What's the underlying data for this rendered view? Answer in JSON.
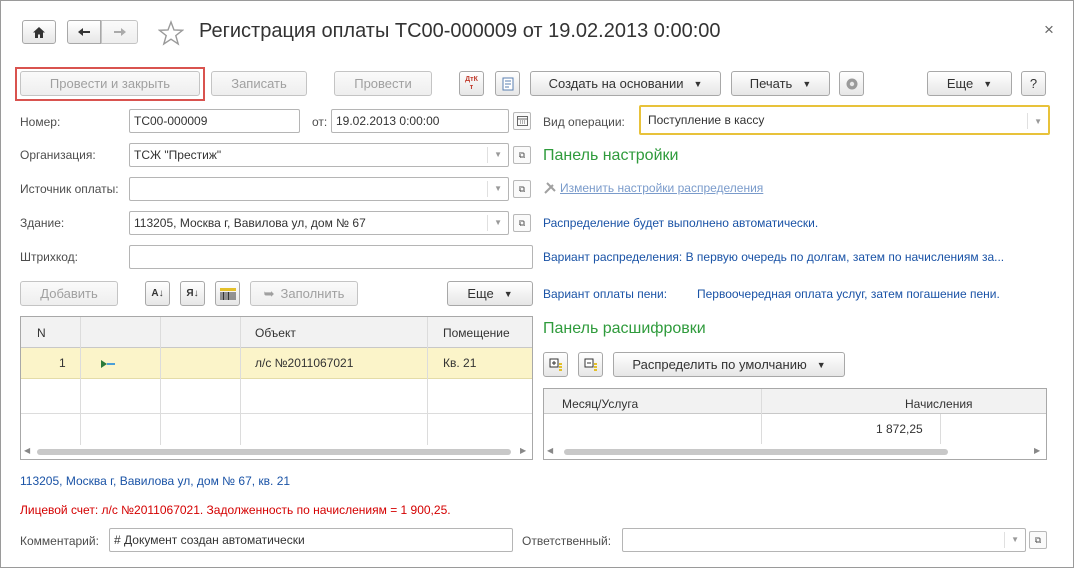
{
  "window": {
    "title": "Регистрация оплаты ТС00-000009 от 19.02.2013 0:00:00",
    "home_icon": "home-icon",
    "back_icon": "arrow-left-icon",
    "forward_icon": "arrow-right-icon",
    "favorite_icon": "star-icon",
    "close_icon": "close-icon",
    "close_glyph": "×"
  },
  "toolbar": {
    "post_close": "Провести и закрыть",
    "save": "Записать",
    "post": "Провести",
    "dtkt": "ДтКт",
    "create_based_on": "Создать на основании",
    "print": "Печать",
    "more": "Еще",
    "help": "?"
  },
  "form": {
    "number_label": "Номер:",
    "number_value": "ТС00-000009",
    "from_label": "от:",
    "date_value": "19.02.2013  0:00:00",
    "org_label": "Организация:",
    "org_value": "ТСЖ \"Престиж\"",
    "source_label": "Источник оплаты:",
    "source_value": "",
    "building_label": "Здание:",
    "building_value": "113205, Москва г, Вавилова ул, дом № 67",
    "barcode_label": "Штрихкод:",
    "barcode_value": "",
    "operation_label": "Вид операции:",
    "operation_value": "Поступление в кассу"
  },
  "table_toolbar": {
    "add": "Добавить",
    "fill": "Заполнить",
    "more": "Еще"
  },
  "table": {
    "columns": [
      "N",
      "",
      "",
      "Объект",
      "Помещение"
    ],
    "rows": [
      {
        "n": "1",
        "object": "л/с №2011067021",
        "room": "Кв. 21"
      }
    ]
  },
  "settings_panel": {
    "title": "Панель настройки",
    "change_link": "Изменить настройки распределения",
    "auto_text": "Распределение будет выполнено автоматически.",
    "variant_text": "Вариант распределения: В первую очередь по долгам, затем по начислениям за...",
    "penalty_label": "Вариант оплаты пени:",
    "penalty_value": "Первоочередная оплата услуг, затем погашение пени."
  },
  "decode_panel": {
    "title": "Панель расшифровки",
    "distribute_button": "Распределить по умолчанию",
    "columns": [
      "Месяц/Услуга",
      "Начисления"
    ],
    "rows": [
      {
        "month": "",
        "charges": "1 872,25"
      }
    ]
  },
  "footer": {
    "address": "113205, Москва г, Вавилова ул, дом № 67, кв. 21",
    "debt": "Лицевой счет: л/с №2011067021. Задолженность по начислениям = 1 900,25.",
    "comment_label": "Комментарий:",
    "comment_value": "# Документ создан автоматически",
    "responsible_label": "Ответственный:",
    "responsible_value": ""
  },
  "colors": {
    "highlight_border": "#d9534f",
    "operation_border": "#e8c23a",
    "selected_row": "#fbf4c9",
    "panel_green": "#2f9b3c",
    "link_blue": "#1a53a6",
    "debt_red": "#d40000"
  }
}
